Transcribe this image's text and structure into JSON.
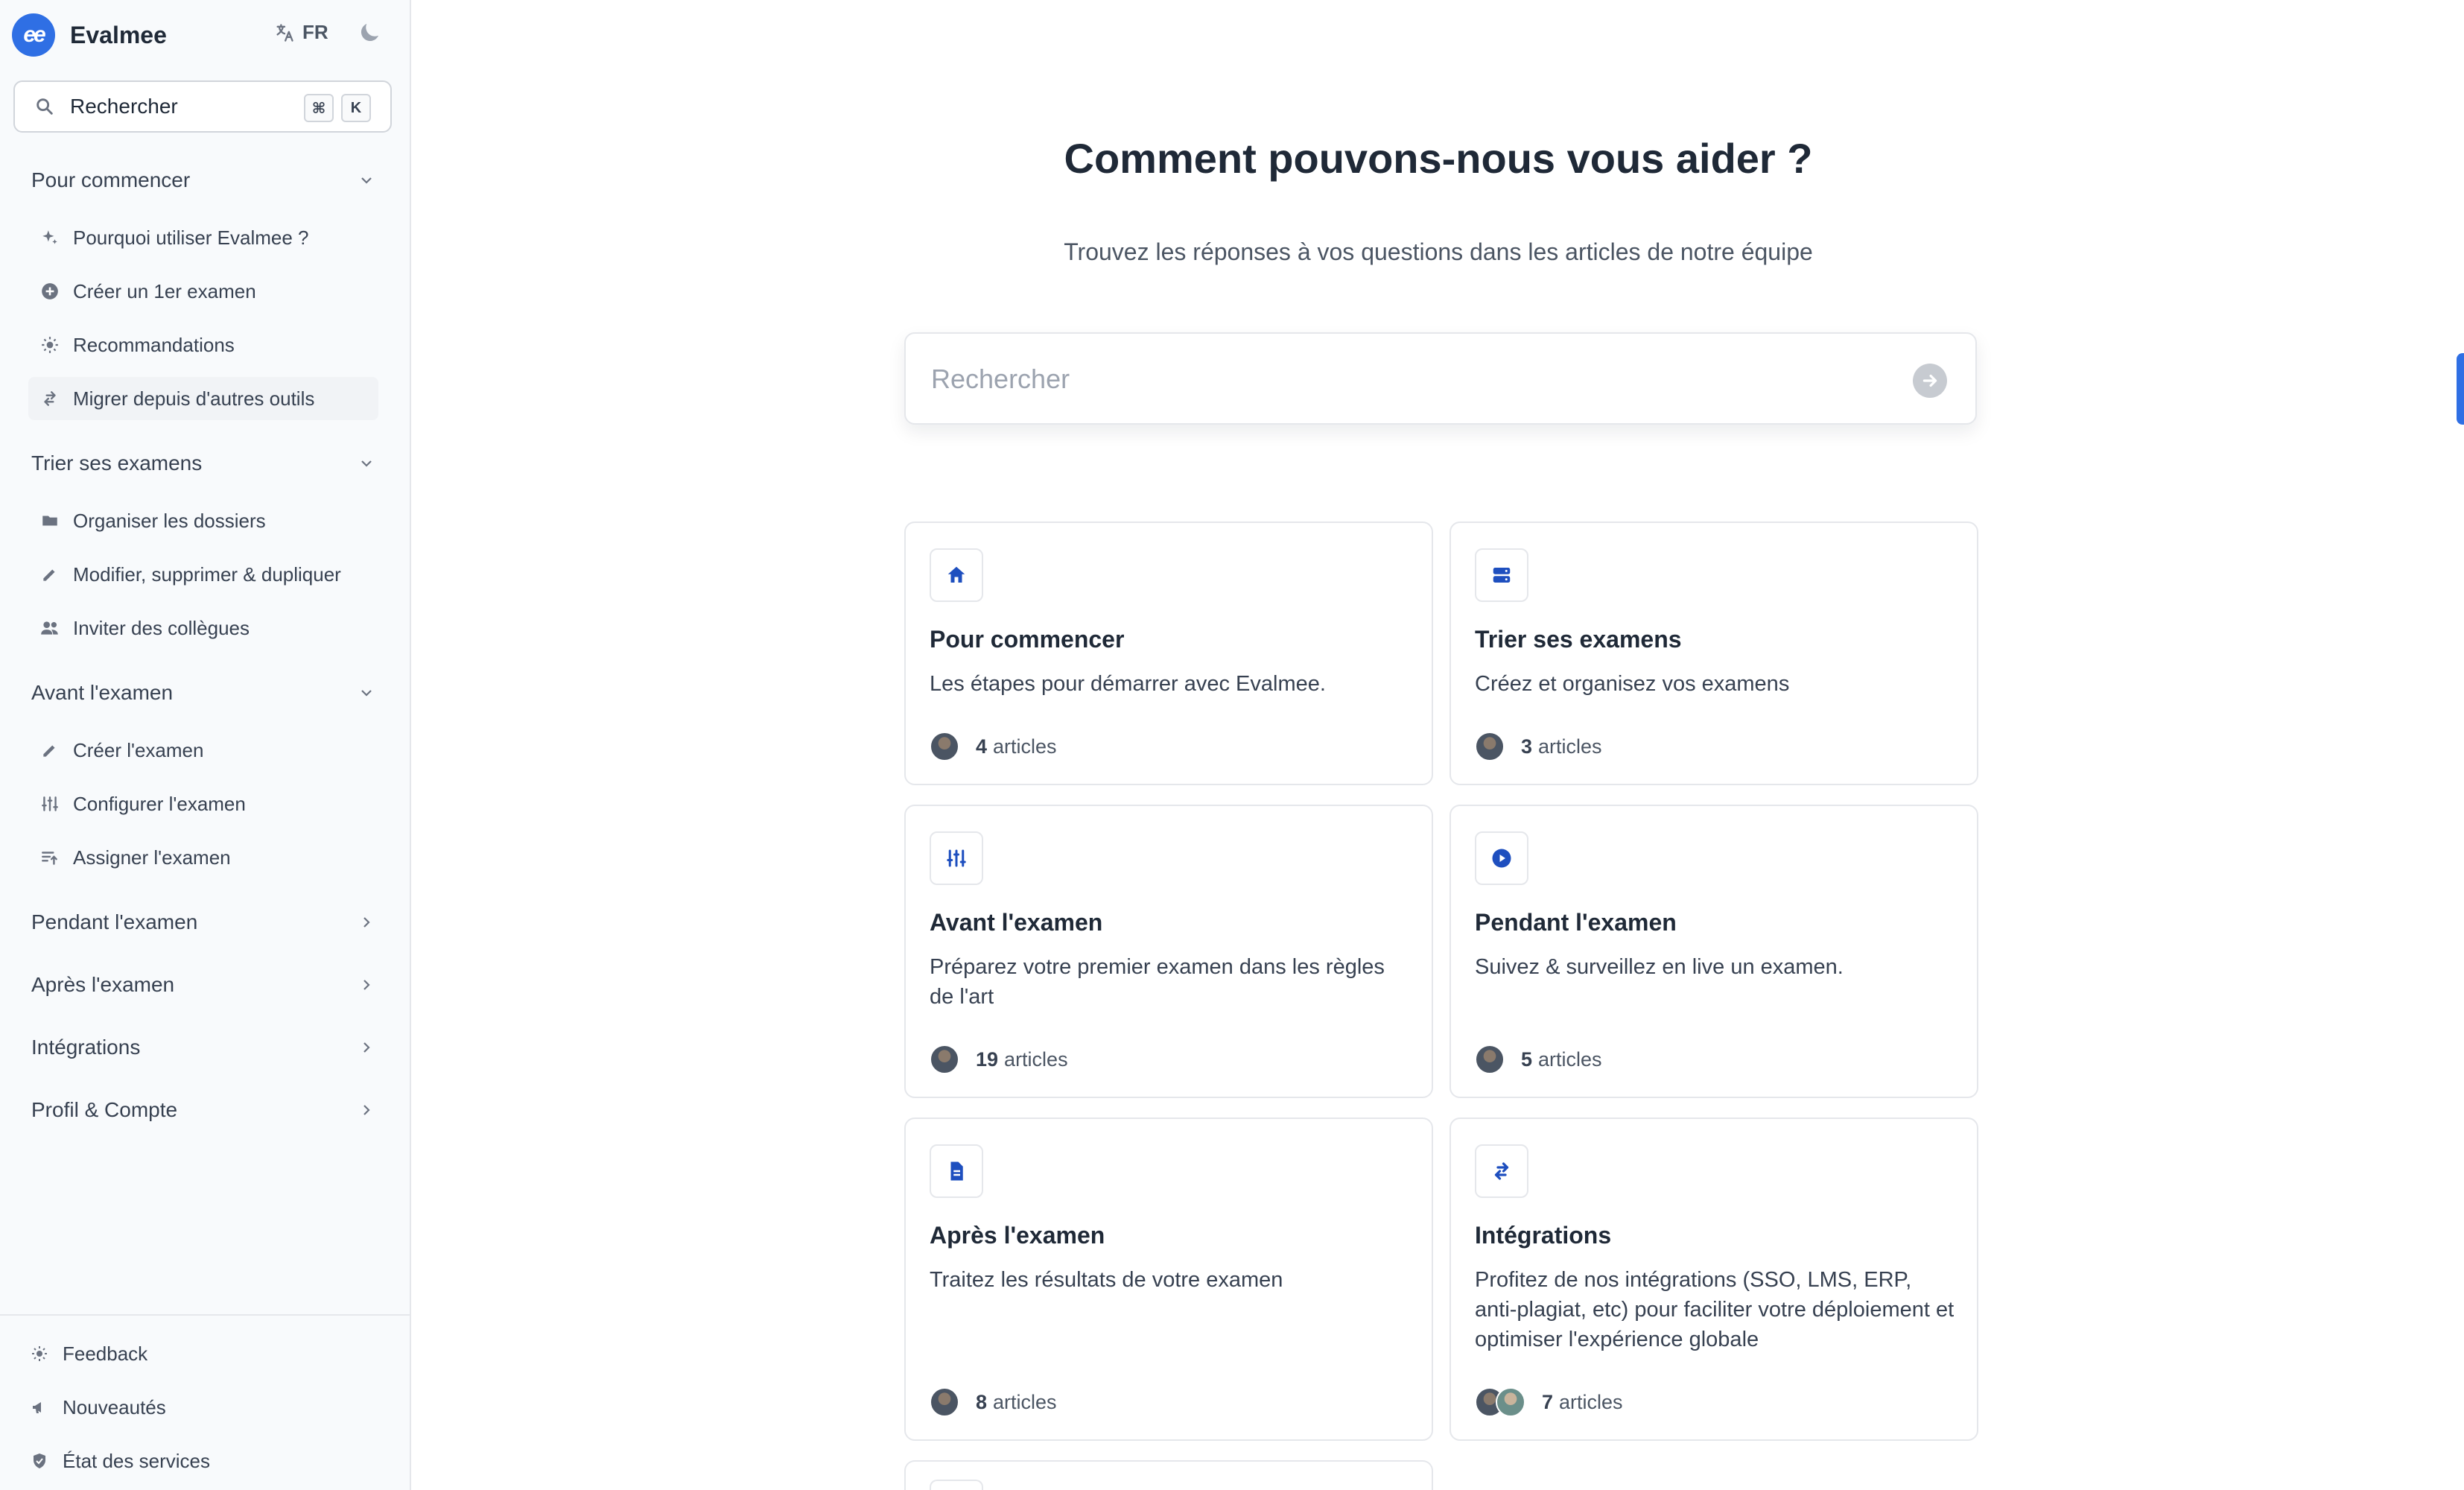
{
  "brand": {
    "name": "Evalmee",
    "logo_text": "ee"
  },
  "lang": {
    "code": "FR"
  },
  "sidebar_search": {
    "placeholder": "Rechercher",
    "kbd1": "⌘",
    "kbd2": "K"
  },
  "nav": {
    "sections": [
      {
        "label": "Pour commencer",
        "expanded": true,
        "items": [
          {
            "label": "Pourquoi utiliser Evalmee ?",
            "icon": "sparkles-icon"
          },
          {
            "label": "Créer un 1er examen",
            "icon": "plus-circle-icon"
          },
          {
            "label": "Recommandations",
            "icon": "lightbulb-icon"
          },
          {
            "label": "Migrer depuis d'autres outils",
            "icon": "swap-icon",
            "active": true
          }
        ]
      },
      {
        "label": "Trier ses examens",
        "expanded": true,
        "items": [
          {
            "label": "Organiser les dossiers",
            "icon": "folder-icon"
          },
          {
            "label": "Modifier, supprimer & dupliquer",
            "icon": "pencil-icon"
          },
          {
            "label": "Inviter des collègues",
            "icon": "users-icon"
          }
        ]
      },
      {
        "label": "Avant l'examen",
        "expanded": true,
        "items": [
          {
            "label": "Créer l'examen",
            "icon": "pencil-icon"
          },
          {
            "label": "Configurer l'examen",
            "icon": "sliders-icon"
          },
          {
            "label": "Assigner l'examen",
            "icon": "assign-icon"
          }
        ]
      },
      {
        "label": "Pendant l'examen",
        "expanded": false
      },
      {
        "label": "Après l'examen",
        "expanded": false
      },
      {
        "label": "Intégrations",
        "expanded": false
      },
      {
        "label": "Profil & Compte",
        "expanded": false
      }
    ]
  },
  "footer": {
    "feedback": "Feedback",
    "news": "Nouveautés",
    "status": "État des services"
  },
  "hero": {
    "title": "Comment pouvons-nous vous aider ?",
    "subtitle": "Trouvez les réponses à vos questions dans les articles de notre équipe",
    "search_placeholder": "Rechercher"
  },
  "cards": [
    {
      "title": "Pour commencer",
      "desc": "Les étapes pour démarrer avec Evalmee.",
      "count": "4",
      "count_label": "articles",
      "icon": "home-icon"
    },
    {
      "title": "Trier ses examens",
      "desc": "Créez et organisez vos examens",
      "count": "3",
      "count_label": "articles",
      "icon": "server-icon"
    },
    {
      "title": "Avant l'examen",
      "desc": "Préparez votre premier examen dans les règles de l'art",
      "count": "19",
      "count_label": "articles",
      "icon": "sliders-icon"
    },
    {
      "title": "Pendant l'examen",
      "desc": "Suivez & surveillez en live un examen.",
      "count": "5",
      "count_label": "articles",
      "icon": "play-circle-icon"
    },
    {
      "title": "Après l'examen",
      "desc": "Traitez les résultats de votre examen",
      "count": "8",
      "count_label": "articles",
      "icon": "document-icon"
    },
    {
      "title": "Intégrations",
      "desc": "Profitez de nos intégrations (SSO, LMS, ERP, anti-plagiat, etc) pour faciliter votre déploiement et optimiser l'expérience globale",
      "count": "7",
      "count_label": "articles",
      "icon": "swap-icon"
    }
  ],
  "colors": {
    "accent": "#2f6fe4",
    "icon_blue": "#1e4fbf",
    "sidebar_bg": "#f8fafc"
  }
}
